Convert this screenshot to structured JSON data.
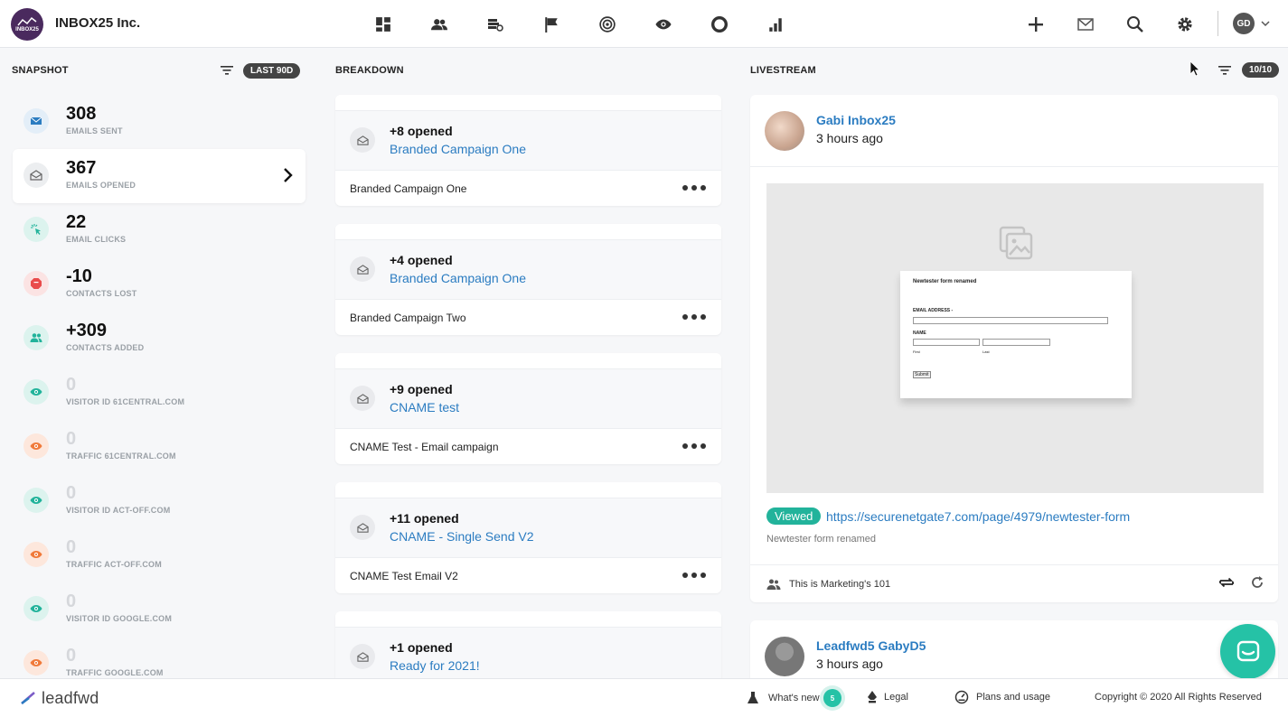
{
  "header": {
    "brand_logo_text": "INBOX25",
    "brand_name": "INBOX25 Inc.",
    "nav_icons": [
      "dashboard-icon",
      "contacts-icon",
      "campaigns-icon",
      "flag-icon",
      "target-icon",
      "eye-icon",
      "circle-icon",
      "bar-chart-icon"
    ],
    "user_initials": "GD"
  },
  "snapshot": {
    "title": "SNAPSHOT",
    "range": "LAST 90D",
    "items": [
      {
        "value": "308",
        "label": "EMAILS SENT",
        "icon": "envelope-icon",
        "color": "#2b7cc1"
      },
      {
        "value": "367",
        "label": "EMAILS OPENED",
        "icon": "envelope-open-icon",
        "color": "#666666"
      },
      {
        "value": "22",
        "label": "EMAIL CLICKS",
        "icon": "cursor-click-icon",
        "color": "#22b39b"
      },
      {
        "value": "-10",
        "label": "CONTACTS LOST",
        "icon": "stop-icon",
        "color": "#e94b4b"
      },
      {
        "value": "+309",
        "label": "CONTACTS ADDED",
        "icon": "users-icon",
        "color": "#22b39b"
      },
      {
        "value": "0",
        "label": "VISITOR ID 61CENTRAL.COM",
        "icon": "eye-icon",
        "color": "#22b39b"
      },
      {
        "value": "0",
        "label": "TRAFFIC 61CENTRAL.COM",
        "icon": "eye-icon",
        "color": "#f07a3a"
      },
      {
        "value": "0",
        "label": "VISITOR ID ACT-OFF.COM",
        "icon": "eye-icon",
        "color": "#22b39b"
      },
      {
        "value": "0",
        "label": "TRAFFIC ACT-OFF.COM",
        "icon": "eye-icon",
        "color": "#f07a3a"
      },
      {
        "value": "0",
        "label": "VISITOR ID GOOGLE.COM",
        "icon": "eye-icon",
        "color": "#22b39b"
      },
      {
        "value": "0",
        "label": "TRAFFIC GOOGLE.COM",
        "icon": "eye-icon",
        "color": "#f07a3a"
      }
    ]
  },
  "breakdown": {
    "title": "BREAKDOWN",
    "cards": [
      {
        "count": "+8 opened",
        "link": "Branded Campaign One",
        "name": "Branded Campaign One"
      },
      {
        "count": "+4 opened",
        "link": "Branded Campaign One",
        "name": "Branded Campaign Two"
      },
      {
        "count": "+9 opened",
        "link": "CNAME test",
        "name": "CNAME Test - Email campaign"
      },
      {
        "count": "+11 opened",
        "link": "CNAME - Single Send V2",
        "name": "CNAME Test Email V2"
      },
      {
        "count": "+1 opened",
        "link": "Ready for 2021!",
        "name": ""
      }
    ]
  },
  "livestream": {
    "title": "LIVESTREAM",
    "count": "10/10",
    "entry1": {
      "name": "Gabi Inbox25",
      "time": "3 hours ago",
      "form_title": "Newtester form renamed",
      "form_email_label": "EMAIL ADDRESS -",
      "form_name_label": "NAME",
      "form_first": "First",
      "form_last": "Last",
      "form_submit": "Submit",
      "badge": "Viewed",
      "url": "https://securenetgate7.com/page/4979/newtester-form",
      "desc": "Newtester form renamed",
      "group": "This is Marketing's 101"
    },
    "entry2": {
      "name": "Leadfwd5 GabyD5",
      "time": "3 hours ago"
    }
  },
  "footer": {
    "logo": "leadfwd",
    "whats_new": "What's new",
    "whats_new_count": "5",
    "legal": "Legal",
    "plans": "Plans and usage",
    "copyright": "Copyright © 2020 All Rights Reserved"
  },
  "colors": {
    "accent": "#2b7cc1",
    "teal": "#25c2a6"
  }
}
